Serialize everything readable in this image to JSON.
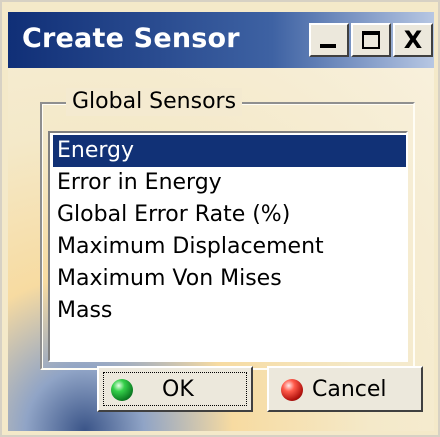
{
  "window": {
    "title": "Create Sensor"
  },
  "titlebar_buttons": {
    "minimize_icon": "minimize-icon",
    "maximize_icon": "maximize-icon",
    "close_label": "X"
  },
  "group": {
    "label": "Global Sensors"
  },
  "sensors": {
    "items": [
      {
        "label": "Energy",
        "selected": true
      },
      {
        "label": "Error in Energy",
        "selected": false
      },
      {
        "label": "Global Error Rate (%)",
        "selected": false
      },
      {
        "label": "Maximum Displacement",
        "selected": false
      },
      {
        "label": "Maximum Von Mises",
        "selected": false
      },
      {
        "label": "Mass",
        "selected": false
      }
    ]
  },
  "buttons": {
    "ok": {
      "label": "OK",
      "icon": "green-ball-icon"
    },
    "cancel": {
      "label": "Cancel",
      "icon": "red-ball-icon"
    }
  },
  "colors": {
    "title_bar_start": "#102f77",
    "selection": "#113176",
    "dialog_background": "#f4e9c9"
  }
}
